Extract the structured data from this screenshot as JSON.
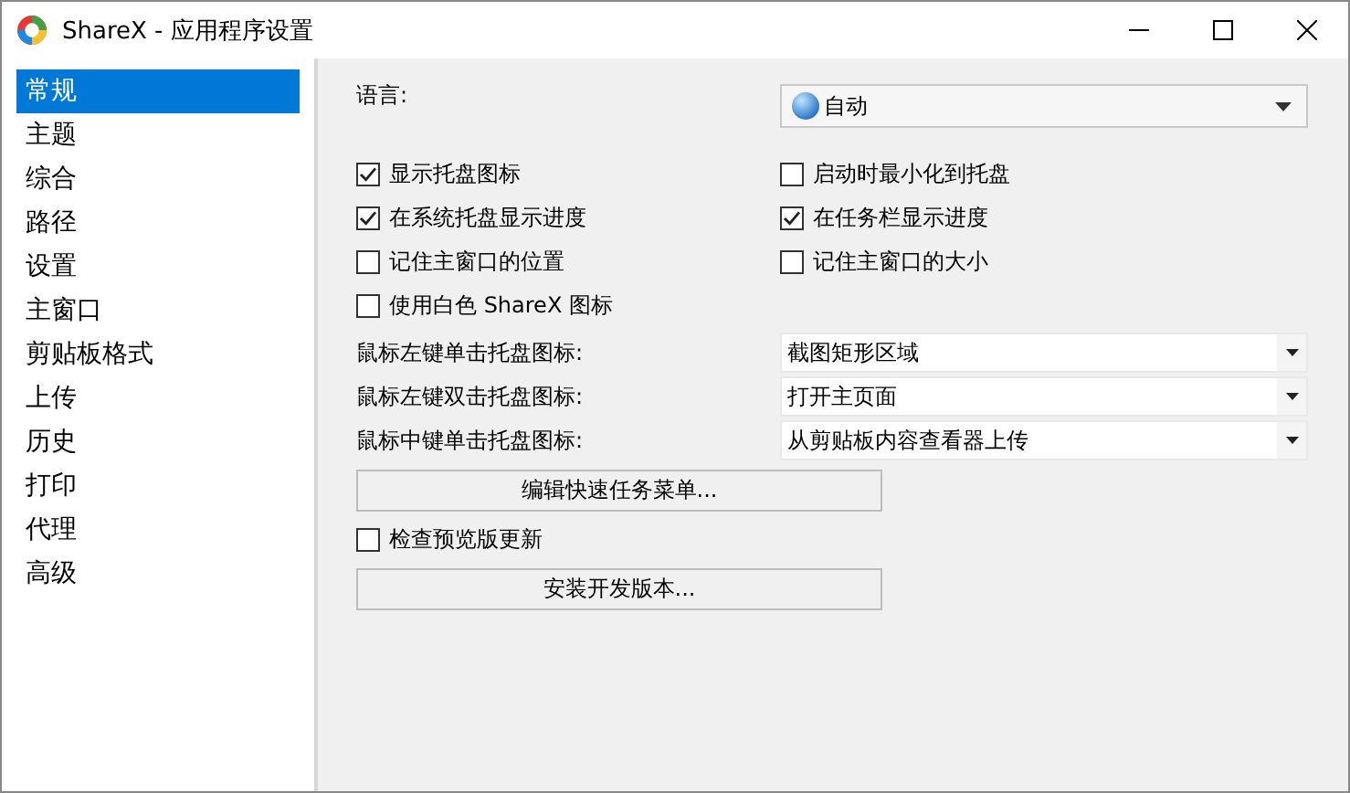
{
  "window": {
    "title": "ShareX - 应用程序设置"
  },
  "sidebar": {
    "items": [
      {
        "label": "常规",
        "selected": true
      },
      {
        "label": "主题",
        "selected": false
      },
      {
        "label": "综合",
        "selected": false
      },
      {
        "label": "路径",
        "selected": false
      },
      {
        "label": "设置",
        "selected": false
      },
      {
        "label": "主窗口",
        "selected": false
      },
      {
        "label": "剪贴板格式",
        "selected": false
      },
      {
        "label": "上传",
        "selected": false
      },
      {
        "label": "历史",
        "selected": false
      },
      {
        "label": "打印",
        "selected": false
      },
      {
        "label": "代理",
        "selected": false
      },
      {
        "label": "高级",
        "selected": false
      }
    ]
  },
  "language": {
    "label": "语言:",
    "value": "自动"
  },
  "checkboxes": [
    {
      "label": "显示托盘图标",
      "checked": true
    },
    {
      "label": "启动时最小化到托盘",
      "checked": false
    },
    {
      "label": "在系统托盘显示进度",
      "checked": true
    },
    {
      "label": "在任务栏显示进度",
      "checked": true
    },
    {
      "label": "记住主窗口的位置",
      "checked": false
    },
    {
      "label": "记住主窗口的大小",
      "checked": false
    },
    {
      "label": "使用白色 ShareX 图标",
      "checked": false
    }
  ],
  "tray_actions": [
    {
      "label": "鼠标左键单击托盘图标:",
      "value": "截图矩形区域"
    },
    {
      "label": "鼠标左键双击托盘图标:",
      "value": "打开主页面"
    },
    {
      "label": "鼠标中键单击托盘图标:",
      "value": "从剪贴板内容查看器上传"
    }
  ],
  "bottom": [
    {
      "kind": "button",
      "label": "编辑快速任务菜单..."
    },
    {
      "kind": "checkbox",
      "label": "检查预览版更新",
      "checked": false
    },
    {
      "kind": "button",
      "label": "安装开发版本..."
    }
  ]
}
